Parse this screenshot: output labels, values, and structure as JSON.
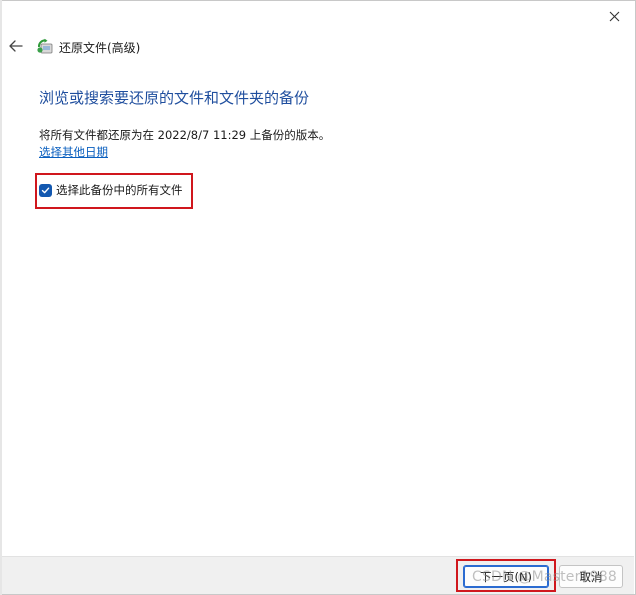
{
  "window": {
    "title": "还原文件(高级)"
  },
  "page": {
    "heading": "浏览或搜索要还原的文件和文件夹的备份",
    "description": "将所有文件都还原为在 2022/8/7 11:29 上备份的版本。",
    "link_label": "选择其他日期",
    "checkbox_label": "选择此备份中的所有文件",
    "checkbox_checked": true
  },
  "footer": {
    "next_label": "下一页(N)",
    "cancel_label": "取消"
  },
  "watermark": "CSDN @Master1988",
  "colors": {
    "heading": "#1f4e9e",
    "link": "#0a5fbf",
    "checkbox": "#1358b0",
    "highlight": "#d0171d",
    "primary_border": "#2b6bd1"
  },
  "icons": {
    "close": "close-icon",
    "back": "back-arrow-icon",
    "app": "backup-restore-icon",
    "check": "checkmark-icon"
  }
}
